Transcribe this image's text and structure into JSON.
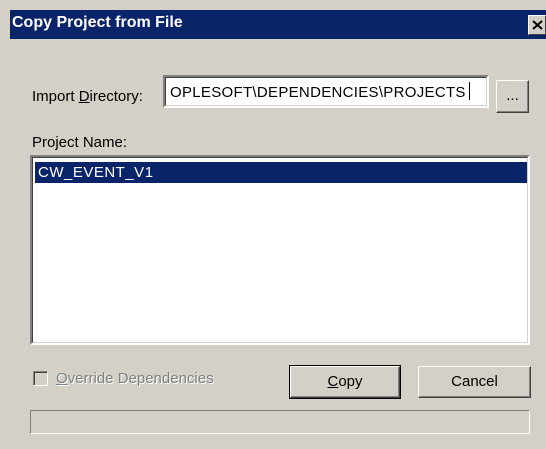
{
  "window": {
    "title": "Copy Project from File",
    "close_icon": "close-icon"
  },
  "import_directory": {
    "label_prefix": "Import ",
    "label_accel": "D",
    "label_suffix": "irectory:",
    "value": "OPLESOFT\\DEPENDENCIES\\PROJECTS",
    "browse_label": "..."
  },
  "project_list": {
    "label": "Project Name:",
    "items": [
      "CW_EVENT_V1"
    ],
    "selected_index": 0
  },
  "override_dependencies": {
    "label_accel": "O",
    "label_rest": "verride Dependencies",
    "checked": false,
    "enabled": false
  },
  "buttons": {
    "copy_accel": "C",
    "copy_rest": "opy",
    "cancel_label": "Cancel"
  },
  "progress": {
    "value": 0
  },
  "colors": {
    "titlebar": "#0a246a",
    "selection": "#0a246a",
    "face": "#d4d0c8"
  }
}
